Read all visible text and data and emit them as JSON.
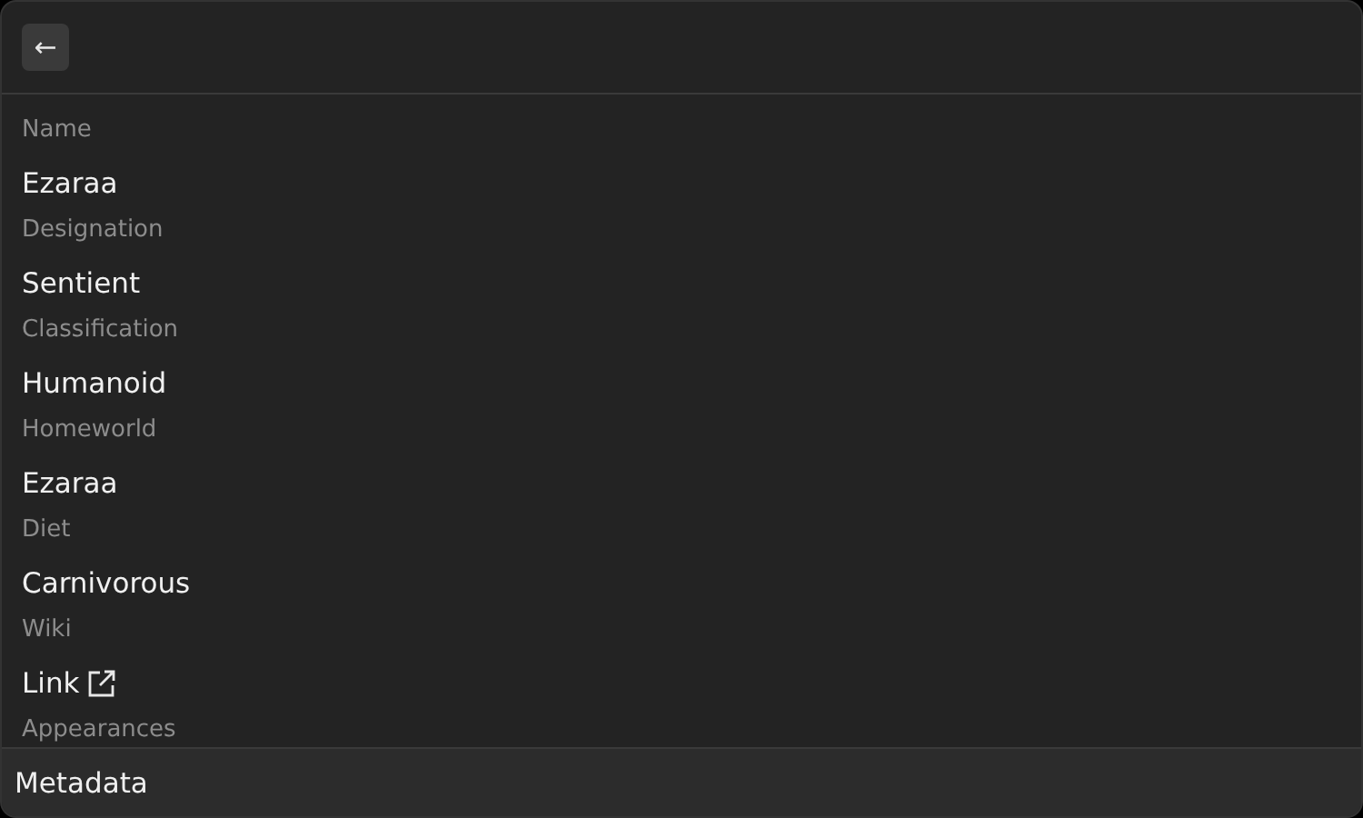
{
  "header": {
    "back_button": "←"
  },
  "fields": [
    {
      "label": "Name",
      "value": "Ezaraa",
      "kind": "text"
    },
    {
      "label": "Designation",
      "value": "Sentient",
      "kind": "text"
    },
    {
      "label": "Classification",
      "value": "Humanoid",
      "kind": "text"
    },
    {
      "label": "Homeworld",
      "value": "Ezaraa",
      "kind": "text"
    },
    {
      "label": "Diet",
      "value": "Carnivorous",
      "kind": "text"
    },
    {
      "label": "Wiki",
      "value": "Link",
      "kind": "link"
    },
    {
      "label": "Appearances",
      "kind": "text"
    }
  ],
  "footer": {
    "title": "Metadata"
  }
}
